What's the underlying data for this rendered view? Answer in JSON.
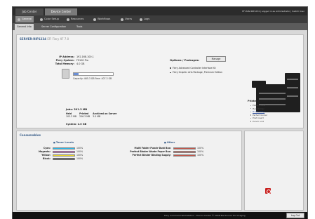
{
  "top_tabs": [
    "Job Center",
    "Device Center"
  ],
  "user_info": "EFI-SRV-RIP1234 | Logged in as Administrator | Switch User",
  "nav": [
    "General",
    "Color Setup",
    "Resources",
    "Workflows",
    "Users",
    "Logs"
  ],
  "subtabs": [
    "General Info",
    "Server Configuration",
    "Tools"
  ],
  "server": {
    "title": "SERVER-RIP1234",
    "subtitle": "EFI Fiery XF 7.0",
    "ip_label": "IP Address:",
    "ip_value": "192.168.100.1",
    "fiery_label": "Fiery System:",
    "fiery_value": "FS100 Pro",
    "memory_label": "Total Memory:",
    "memory_value": "4.0 GB",
    "capacity_text": "Capacity: 465.3 GB  Free: 407.3 GB",
    "disk_free_fraction": 0.12,
    "jobs_title": "Jobs: 391.3 MB",
    "jobs_headers": [
      "Held",
      "Printed",
      "Archived on Server"
    ],
    "jobs_values": [
      "102.3 MB",
      "256.3 MB",
      "3.0 MB"
    ],
    "system_line": "System: 2.0 GB"
  },
  "options": {
    "title": "Options / Packages:",
    "manage_label": "Manage",
    "items": [
      "Fiery Advanced Controller Interface Kit",
      "Fiery Graphic Arts Package, Premium Edition"
    ]
  },
  "installed": {
    "title": "Printer Installed Options",
    "items": [
      "Platen cover",
      "Hard folder",
      "Tri-fold tray",
      "Perfect binder",
      "Post insert",
      "Punch unit"
    ]
  },
  "consumables": {
    "title": "Consumables",
    "toner_head": "Toner Levels",
    "other_head": "Other",
    "toner": [
      {
        "label": "Cyan:",
        "pct": "100%",
        "level": 1.0,
        "color": "#29b7e8"
      },
      {
        "label": "Magenta:",
        "pct": "100%",
        "level": 1.0,
        "color": "#c23fb5"
      },
      {
        "label": "Yellow:",
        "pct": "100%",
        "level": 1.0,
        "color": "#e8d22a"
      },
      {
        "label": "Black:",
        "pct": "100%",
        "level": 1.0,
        "color": "#1a1a1a"
      }
    ],
    "other": [
      {
        "label": "Multi Folder Punch-Dust Box:",
        "pct": "100%",
        "level": 1.0,
        "color": "#c2564a"
      },
      {
        "label": "Perfect Binder Waste Paper Box:",
        "pct": "100%",
        "level": 1.0,
        "color": "#c2564a"
      },
      {
        "label": "Perfect Binder Binding Supply:",
        "pct": "100%",
        "level": 1.0,
        "color": "#c2564a"
      }
    ]
  },
  "footer": {
    "text": "Fiery Command WorkStation - Device Center © 2008 Electronics For Imaging",
    "logout_label": "Log Out"
  }
}
